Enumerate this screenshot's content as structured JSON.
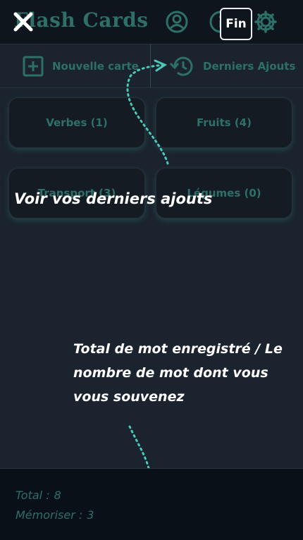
{
  "header": {
    "app_title": "Flash Cards",
    "fin_label": "Fin"
  },
  "toolbar": {
    "new_card_label": "Nouvelle carte",
    "recent_label": "Derniers Ajouts"
  },
  "categories": [
    {
      "label": "Verbes (1)"
    },
    {
      "label": "Fruits (4)"
    },
    {
      "label": "Transport (3)"
    },
    {
      "label": "Légumes (0)"
    }
  ],
  "annotations": {
    "recent_hint": "Voir vos derniers ajouts",
    "totals_hint": "Total de mot enregistré / Le nombre de mot dont vous vous souvenez"
  },
  "footer": {
    "total_label": "Total :",
    "total_value": "8",
    "memorized_label": "Mémoriser :",
    "memorized_value": "3"
  },
  "colors": {
    "accent": "#2e6f68",
    "background": "#1b232e",
    "header_bg": "#0f151d",
    "arrow": "#49c9b6"
  },
  "icons": [
    "close-icon",
    "account-icon",
    "info-icon",
    "gear-icon",
    "plus-square-icon",
    "history-icon"
  ]
}
